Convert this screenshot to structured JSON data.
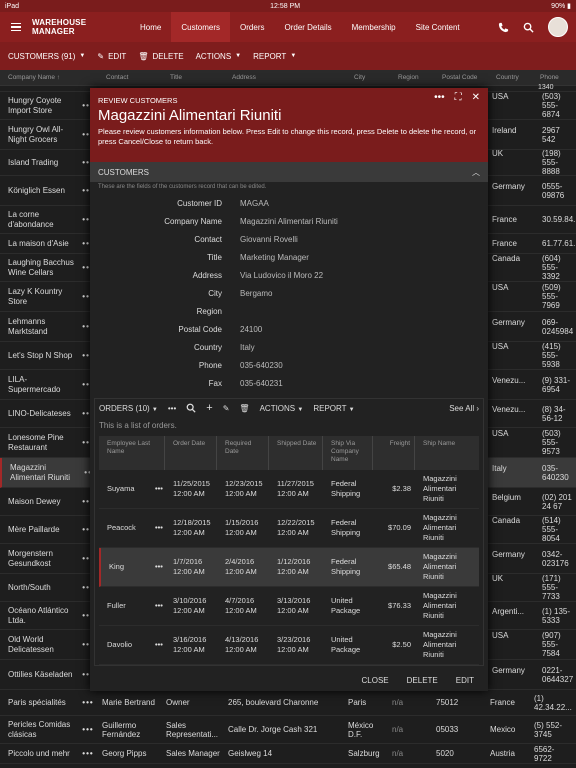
{
  "status": {
    "left": "iPad",
    "time": "12:58 PM",
    "battery": "90%"
  },
  "app": {
    "title": "WAREHOUSE MANAGER"
  },
  "nav": [
    "Home",
    "Customers",
    "Orders",
    "Order Details",
    "Membership",
    "Site Content"
  ],
  "toolbar": {
    "customers": "CUSTOMERS (91)",
    "edit": "EDIT",
    "delete": "DELETE",
    "actions": "ACTIONS",
    "report": "REPORT"
  },
  "grid": {
    "headers": [
      "Company Name",
      "Contact",
      "Title",
      "Address",
      "City",
      "Region",
      "Postal Code",
      "Country",
      "Phone"
    ],
    "rows": [
      {
        "name": "",
        "country": "",
        "phone": "1340"
      },
      {
        "name": "Hungry Coyote Import Store",
        "country": "USA",
        "phone": "(503) 555-6874"
      },
      {
        "name": "Hungry Owl All-Night Grocers",
        "country": "Ireland",
        "phone": "2967 542"
      },
      {
        "name": "Island Trading",
        "country": "UK",
        "phone": "(198) 555-8888"
      },
      {
        "name": "Königlich Essen",
        "country": "Germany",
        "phone": "0555-09876"
      },
      {
        "name": "La corne d'abondance",
        "country": "France",
        "phone": "30.59.84.10"
      },
      {
        "name": "La maison d'Asie",
        "country": "France",
        "phone": "61.77.61.10"
      },
      {
        "name": "Laughing Bacchus Wine Cellars",
        "country": "Canada",
        "phone": "(604) 555-3392"
      },
      {
        "name": "Lazy K Kountry Store",
        "country": "USA",
        "phone": "(509) 555-7969"
      },
      {
        "name": "Lehmanns Marktstand",
        "country": "Germany",
        "phone": "069-0245984"
      },
      {
        "name": "Let's Stop N Shop",
        "country": "USA",
        "phone": "(415) 555-5938"
      },
      {
        "name": "LILA-Supermercado",
        "country": "Venezu...",
        "phone": "(9) 331-6954"
      },
      {
        "name": "LINO-Delicateses",
        "country": "Venezu...",
        "phone": "(8) 34-56-12"
      },
      {
        "name": "Lonesome Pine Restaurant",
        "country": "USA",
        "phone": "(503) 555-9573"
      },
      {
        "name": "Magazzini Alimentari Riuniti",
        "country": "Italy",
        "phone": "035-640230"
      },
      {
        "name": "Maison Dewey",
        "country": "Belgium",
        "phone": "(02) 201 24 67"
      },
      {
        "name": "Mère Paillarde",
        "country": "Canada",
        "phone": "(514) 555-8054"
      },
      {
        "name": "Morgenstern Gesundkost",
        "country": "Germany",
        "phone": "0342-023176"
      },
      {
        "name": "North/South",
        "country": "UK",
        "phone": "(171) 555-7733"
      },
      {
        "name": "Océano Atlántico Ltda.",
        "country": "Argenti...",
        "phone": "(1) 135-5333"
      },
      {
        "name": "Old World Delicatessen",
        "country": "USA",
        "phone": "(907) 555-7584"
      },
      {
        "name": "Ottilies Käseladen",
        "country": "Germany",
        "phone": "0221-0644327"
      }
    ],
    "full_rows": [
      {
        "name": "Paris spécialités",
        "contact": "Marie Bertrand",
        "title": "Owner",
        "address": "265, boulevard Charonne",
        "city": "Paris",
        "region": "n/a",
        "postal": "75012",
        "country": "France",
        "phone": "(1) 42.34.22..."
      },
      {
        "name": "Pericles Comidas clásicas",
        "contact": "Guillermo Fernández",
        "title": "Sales Representati...",
        "address": "Calle Dr. Jorge Cash 321",
        "city": "México D.F.",
        "region": "n/a",
        "postal": "05033",
        "country": "Mexico",
        "phone": "(5) 552-3745"
      },
      {
        "name": "Piccolo und mehr",
        "contact": "Georg Pipps",
        "title": "Sales Manager",
        "address": "Geislweg 14",
        "city": "Salzburg",
        "region": "n/a",
        "postal": "5020",
        "country": "Austria",
        "phone": "6562-9722"
      }
    ]
  },
  "modal": {
    "label": "REVIEW CUSTOMERS",
    "title": "Magazzini Alimentari Riuniti",
    "desc": "Please review customers information below. Press Edit to change this record, press Delete to delete the record, or press Cancel/Close to return back.",
    "section": "CUSTOMERS",
    "section_hint": "These are the fields of the customers record that can be edited.",
    "fields": [
      {
        "label": "Customer ID",
        "value": "MAGAA"
      },
      {
        "label": "Company Name",
        "value": "Magazzini Alimentari Riuniti"
      },
      {
        "label": "Contact",
        "value": "Giovanni Rovelli"
      },
      {
        "label": "Title",
        "value": "Marketing Manager"
      },
      {
        "label": "Address",
        "value": "Via Ludovico il Moro 22"
      },
      {
        "label": "City",
        "value": "Bergamo"
      },
      {
        "label": "Region",
        "value": ""
      },
      {
        "label": "Postal Code",
        "value": "24100"
      },
      {
        "label": "Country",
        "value": "Italy"
      },
      {
        "label": "Phone",
        "value": "035-640230"
      },
      {
        "label": "Fax",
        "value": "035-640231"
      }
    ],
    "orders": {
      "title": "ORDERS (10)",
      "actions": "ACTIONS",
      "report": "REPORT",
      "see_all": "See All",
      "hint": "This is a list of orders.",
      "headers": [
        "Employee Last Name",
        "Order Date",
        "Required Date",
        "Shipped Date",
        "Ship Via Company Name",
        "Freight",
        "Ship Name"
      ],
      "rows": [
        {
          "emp": "Suyama",
          "order": "11/25/2015 12:00 AM",
          "req": "12/23/2015 12:00 AM",
          "ship": "11/27/2015 12:00 AM",
          "via": "Federal Shipping",
          "freight": "$2.38",
          "name": "Magazzini Alimentari Riuniti"
        },
        {
          "emp": "Peacock",
          "order": "12/18/2015 12:00 AM",
          "req": "1/15/2016 12:00 AM",
          "ship": "12/22/2015 12:00 AM",
          "via": "Federal Shipping",
          "freight": "$70.09",
          "name": "Magazzini Alimentari Riuniti"
        },
        {
          "emp": "King",
          "order": "1/7/2016 12:00 AM",
          "req": "2/4/2016 12:00 AM",
          "ship": "1/12/2016 12:00 AM",
          "via": "Federal Shipping",
          "freight": "$65.48",
          "name": "Magazzini Alimentari Riuniti"
        },
        {
          "emp": "Fuller",
          "order": "3/10/2016 12:00 AM",
          "req": "4/7/2016 12:00 AM",
          "ship": "3/13/2016 12:00 AM",
          "via": "United Package",
          "freight": "$76.33",
          "name": "Magazzini Alimentari Riuniti"
        },
        {
          "emp": "Davolio",
          "order": "3/16/2016 12:00 AM",
          "req": "4/13/2016 12:00 AM",
          "ship": "3/23/2016 12:00 AM",
          "via": "United Package",
          "freight": "$2.50",
          "name": "Magazzini Alimentari Riuniti"
        }
      ]
    },
    "footer": {
      "close": "CLOSE",
      "delete": "DELETE",
      "edit": "EDIT"
    }
  }
}
